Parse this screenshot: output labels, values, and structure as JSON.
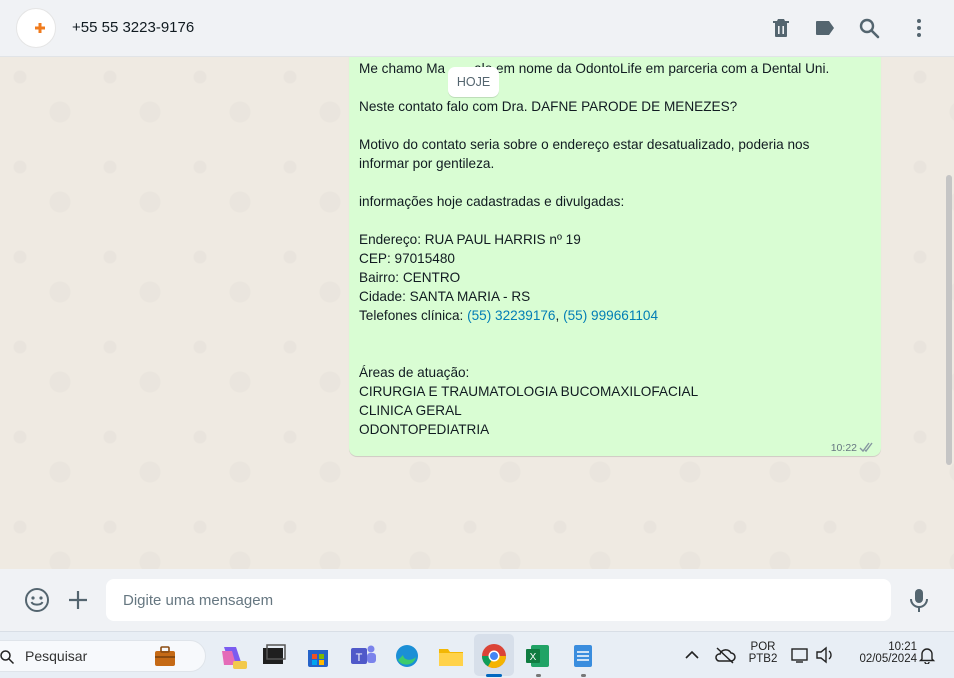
{
  "header": {
    "contact_name": "+55 55 3223-9176",
    "icons": [
      "delete-icon",
      "label-icon",
      "search-icon",
      "more-options-icon"
    ]
  },
  "chat": {
    "date_badge": "HOJE",
    "message": {
      "line1": "Me chamo Ma",
      "line1_end": "alo em nome da OdontoLife em parceria com a Dental Uni.",
      "line2": "Neste contato falo com Dra. DAFNE PARODE DE MENEZES?",
      "line3a": "Motivo do contato seria sobre o endereço estar desatualizado, poderia nos",
      "line3b": "informar por gentileza.",
      "line4": "informações hoje cadastradas e divulgadas:",
      "endereco": "Endereço: RUA PAUL HARRIS nº 19",
      "cep": "CEP: 97015480",
      "bairro": "Bairro: CENTRO",
      "cidade": "Cidade: SANTA MARIA - RS",
      "telefones_label": "Telefones clínica: ",
      "phone1": "(55) 32239176",
      "phone_sep": ", ",
      "phone2": "(55) 999661104",
      "areas_label": "Áreas de atuação:",
      "area1": "CIRURGIA E TRAUMATOLOGIA BUCOMAXILOFACIAL",
      "area2": "CLINICA GERAL",
      "area3": "ODONTOPEDIATRIA",
      "time": "10:22"
    }
  },
  "composer": {
    "placeholder": "Digite uma mensagem"
  },
  "taskbar": {
    "search_label": "Pesquisar",
    "lang_top": "POR",
    "lang_bottom": "PTB2",
    "clock_time": "10:21",
    "clock_date": "02/05/2024"
  },
  "colors": {
    "outgoing_bubble": "#d9fdd3",
    "chat_background": "#efeae2",
    "header_background": "#f0f2f5",
    "link": "#027eb5"
  }
}
